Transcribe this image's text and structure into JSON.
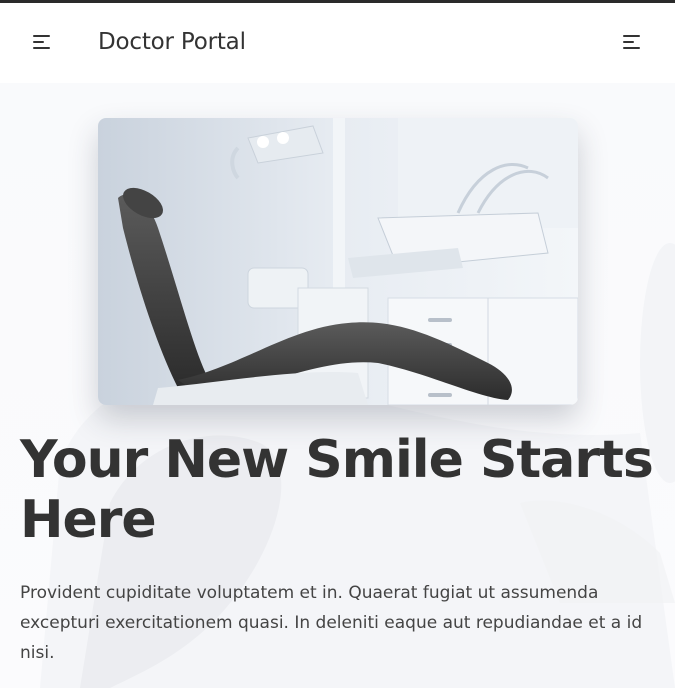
{
  "header": {
    "brand": "Doctor Portal",
    "left_menu_icon": "menu-icon",
    "right_menu_icon": "menu-icon"
  },
  "hero": {
    "image_alt": "dental chair",
    "headline": "Your New Smile Starts Here",
    "lead": "Provident cupiditate voluptatem et in. Quaerat fugiat ut assumenda excepturi exercitationem quasi. In deleniti eaque aut repudiandae et a id nisi."
  },
  "colors": {
    "text": "#333333",
    "top_border": "#2a2a2a",
    "hero_bg": "#f9fafc"
  }
}
